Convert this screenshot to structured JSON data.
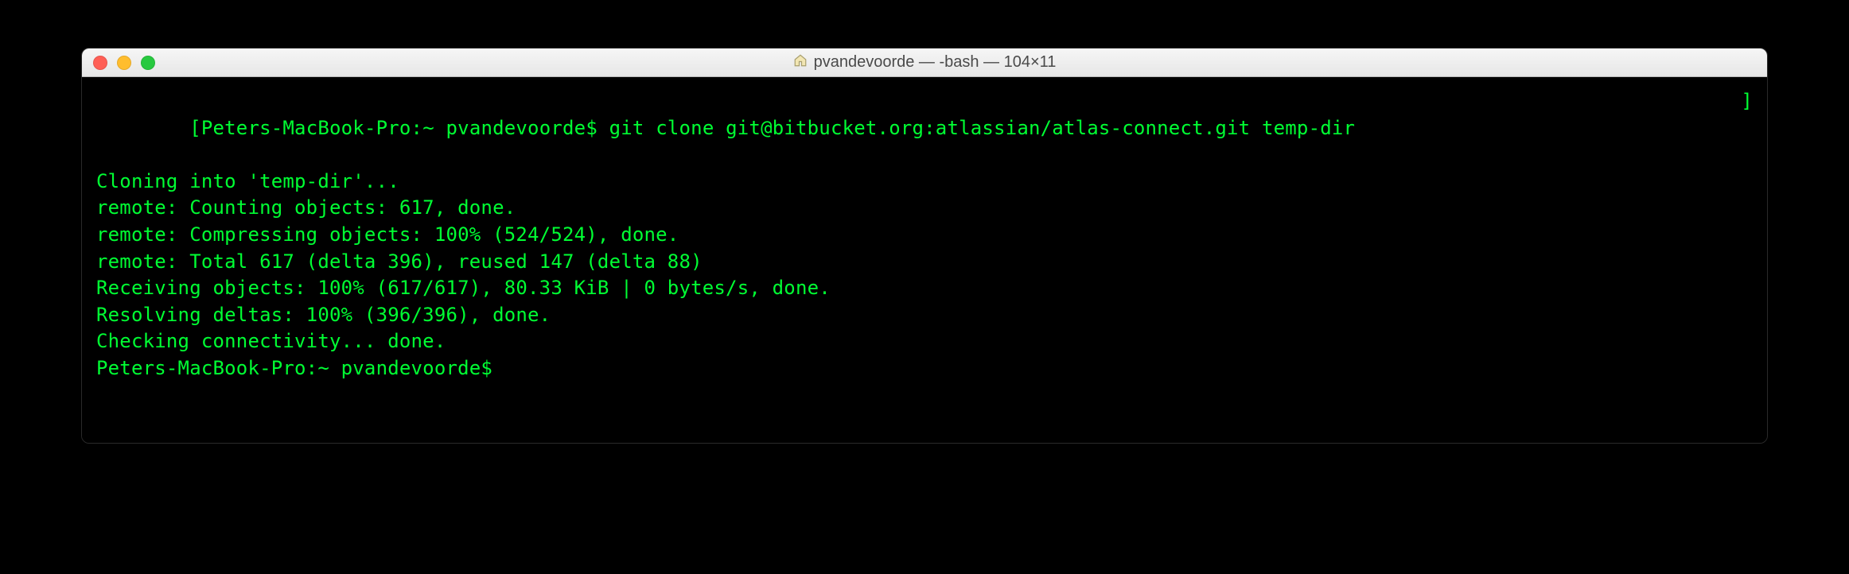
{
  "window": {
    "title": "pvandevoorde — -bash — 104×11"
  },
  "prompt": {
    "host": "Peters-MacBook-Pro",
    "path": "~",
    "user": "pvandevoorde",
    "sep1": ":",
    "dollar": "$"
  },
  "command": "git clone git@bitbucket.org:atlassian/atlas-connect.git temp-dir",
  "brackets": {
    "open": "[",
    "close": "]"
  },
  "output": {
    "l1": "Cloning into 'temp-dir'...",
    "l2": "remote: Counting objects: 617, done.",
    "l3": "remote: Compressing objects: 100% (524/524), done.",
    "l4": "remote: Total 617 (delta 396), reused 147 (delta 88)",
    "l5": "Receiving objects: 100% (617/617), 80.33 KiB | 0 bytes/s, done.",
    "l6": "Resolving deltas: 100% (396/396), done.",
    "l7": "Checking connectivity... done."
  },
  "prompt2_full": "Peters-MacBook-Pro:~ pvandevoorde$ "
}
